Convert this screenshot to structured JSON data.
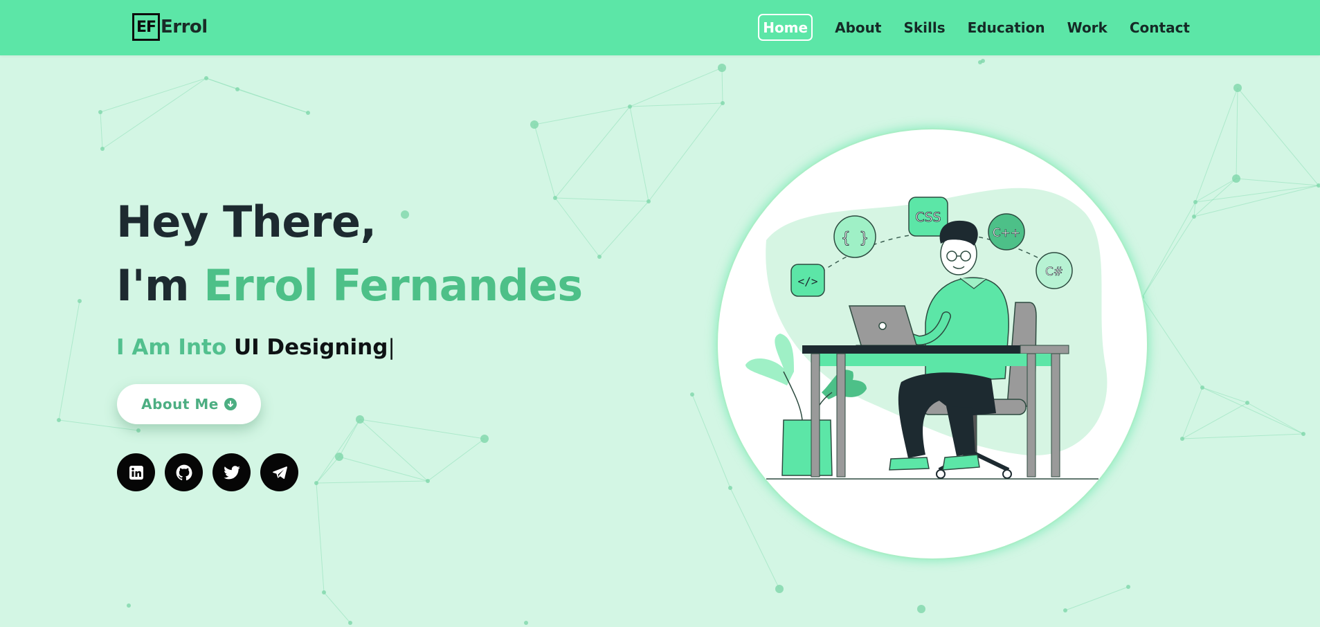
{
  "logo": {
    "mark": "EF",
    "name": "Errol"
  },
  "nav": {
    "items": [
      {
        "label": "Home",
        "active": true
      },
      {
        "label": "About"
      },
      {
        "label": "Skills"
      },
      {
        "label": "Education"
      },
      {
        "label": "Work"
      },
      {
        "label": "Contact"
      }
    ]
  },
  "hero": {
    "greeting": "Hey There,",
    "intro_prefix": "I'm",
    "name": "Errol Fernandes",
    "typed_prefix": "I Am Into",
    "typed_text": "UI Designing",
    "caret": "|",
    "button_label": "About Me",
    "button_icon": "arrow-circle-down-icon"
  },
  "socials": [
    {
      "name": "linkedin-icon"
    },
    {
      "name": "github-icon"
    },
    {
      "name": "twitter-icon"
    },
    {
      "name": "telegram-icon"
    }
  ],
  "illustration": {
    "bubbles": [
      "</>",
      "{ }",
      "CSS",
      "C++",
      "C#"
    ]
  },
  "colors": {
    "header_bg": "#5ce6a7",
    "page_bg": "#d3f6e4",
    "accent": "#4dc088",
    "dark": "#1d2a30"
  }
}
